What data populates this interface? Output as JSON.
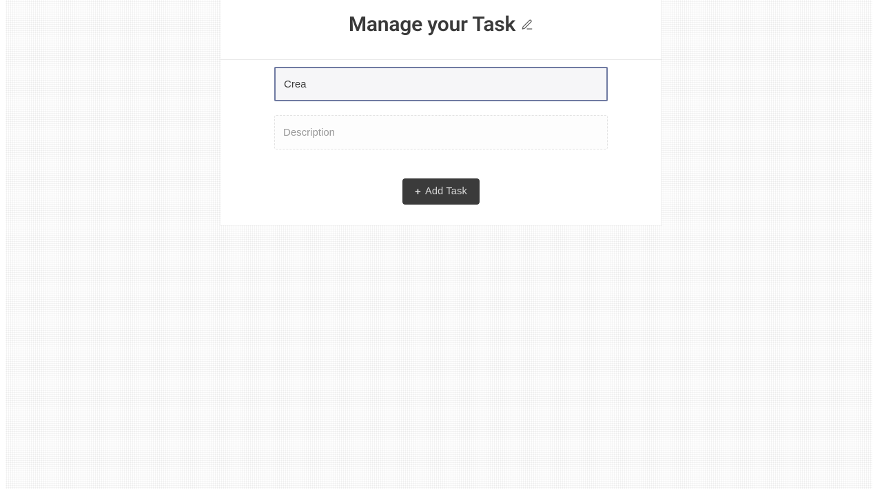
{
  "header": {
    "title": "Manage your Task",
    "icon": "edit-note-icon"
  },
  "form": {
    "title_input": {
      "value": "Crea",
      "placeholder": ""
    },
    "description_input": {
      "value": "",
      "placeholder": "Description"
    }
  },
  "buttons": {
    "add_task_label": "Add Task"
  }
}
